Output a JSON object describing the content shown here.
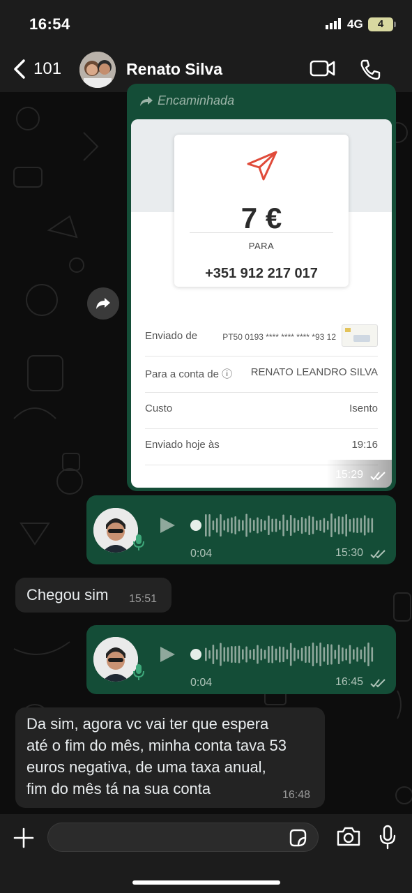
{
  "status_bar": {
    "time": "16:54",
    "network": "4G",
    "battery": "4"
  },
  "header": {
    "back_count": "101",
    "contact_name": "Renato Silva"
  },
  "messages": {
    "forwarded": {
      "label": "Encaminhada",
      "receipt": {
        "amount": "7 €",
        "to_label": "PARA",
        "phone": "+351 912 217 017",
        "rows": [
          {
            "label": "Enviado de",
            "value": "PT50 0193 **** **** **** *93 12"
          },
          {
            "label": "Para a conta de ⓘ",
            "value": "RENATO LEANDRO SILVA"
          },
          {
            "label": "Custo",
            "value": "Isento"
          },
          {
            "label": "Enviado hoje às",
            "value": "19:16"
          }
        ]
      },
      "time": "15:29"
    },
    "voice1": {
      "duration": "0:04",
      "time": "15:30"
    },
    "text1": {
      "text": "Chegou sim",
      "time": "15:51"
    },
    "voice2": {
      "duration": "0:04",
      "time": "16:45"
    },
    "text2": {
      "lines": [
        "Da sim, agora vc vai ter que espera",
        "até o fim do mês, minha conta tava 53",
        "euros negativa, de uma taxa anual,",
        "fim do mês tá na sua conta"
      ],
      "time": "16:48"
    }
  },
  "colors": {
    "outgoing": "#144d37",
    "incoming": "#232323",
    "accent": "#e04b3a"
  },
  "icons": [
    "back-chevron-icon",
    "video-call-icon",
    "phone-icon",
    "forward-arrow-icon",
    "play-icon",
    "mic-icon",
    "plus-icon",
    "sticker-icon",
    "camera-icon",
    "double-check-icon",
    "paper-plane-icon"
  ]
}
